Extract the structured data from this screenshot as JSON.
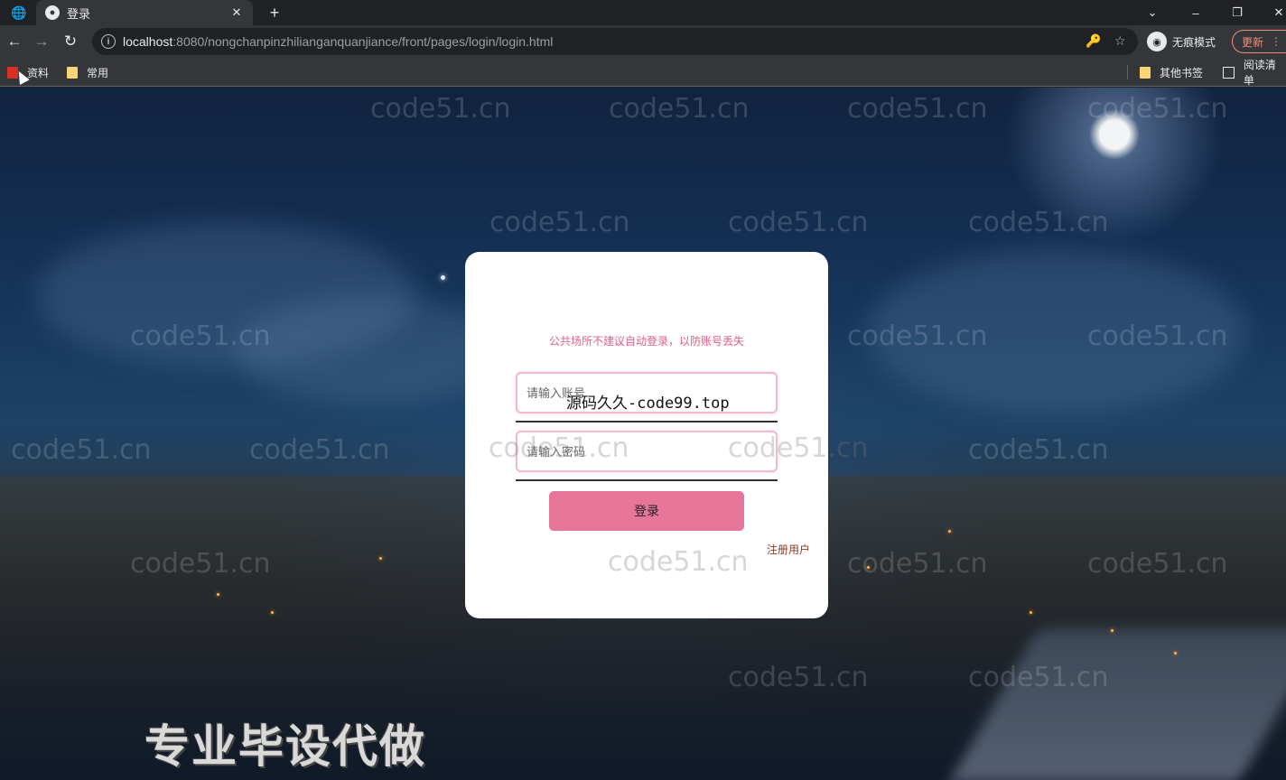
{
  "browser": {
    "tab_title": "登录",
    "url_host": "localhost",
    "url_path": ":8080/nongchanpinzhilianganquanjiance/front/pages/login/login.html",
    "incognito_label": "无痕模式",
    "update_label": "更新",
    "bookmarks": [
      {
        "label": "资料"
      },
      {
        "label": "常用"
      }
    ],
    "other_bookmarks_label": "其他书签",
    "reading_list_label": "阅读清单"
  },
  "page": {
    "watermark": "code51.cn",
    "login": {
      "notice": "公共场所不建议自动登录，以防账号丢失",
      "username_placeholder": "请输入账号",
      "password_placeholder": "请输入密码",
      "overlay_text": "源码久久-code99.top",
      "submit_label": "登录",
      "register_label": "注册用户"
    },
    "banner": "专业毕设代做"
  },
  "colors": {
    "accent": "#e8759a",
    "notice": "#e05c84",
    "register_link": "#8a3a1e"
  }
}
